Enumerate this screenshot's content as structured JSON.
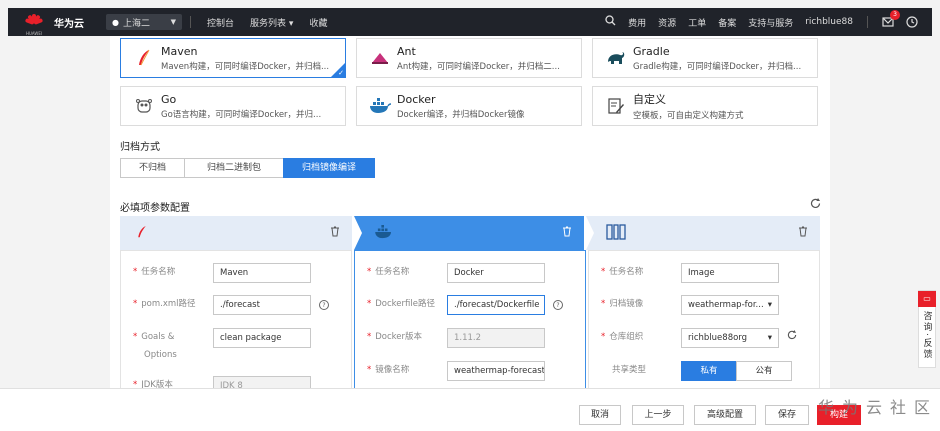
{
  "nav": {
    "brand": "华为云",
    "brand_sub": "HUAWEI",
    "region": "上海二",
    "links": [
      "控制台",
      "服务列表",
      "收藏"
    ],
    "service_caret": "▾",
    "right_links": [
      "费用",
      "资源",
      "工单",
      "备案",
      "支持与服务",
      "richblue88"
    ],
    "badge_count": "3"
  },
  "templates": [
    {
      "name": "Maven",
      "desc": "Maven构建，可同时编译Docker，并归档...",
      "icon": "maven-feather-icon",
      "selected": true
    },
    {
      "name": "Ant",
      "desc": "Ant构建，可同时编译Docker，并归档二...",
      "icon": "ant-icon"
    },
    {
      "name": "Gradle",
      "desc": "Gradle构建，可同时编译Docker，并归档...",
      "icon": "gradle-elephant-icon"
    },
    {
      "name": "Go",
      "desc": "Go语言构建，可同时编译Docker，并归...",
      "icon": "go-gopher-icon"
    },
    {
      "name": "Docker",
      "desc": "Docker编译，并归档Docker镜像",
      "icon": "docker-whale-icon"
    },
    {
      "name": "自定义",
      "desc": "空模板，可自由定义构建方式",
      "icon": "custom-edit-icon"
    }
  ],
  "archive": {
    "title": "归档方式",
    "options": [
      "不归档",
      "归档二进制包",
      "归档镜像编译"
    ],
    "selected": 2
  },
  "params": {
    "title": "必填项参数配置",
    "maven": {
      "fields": [
        {
          "label": "任务名称",
          "value": "Maven"
        },
        {
          "label": "pom.xml路径",
          "value": "./forecast"
        },
        {
          "label": "Goals &",
          "label2": "Options",
          "value": "clean package"
        },
        {
          "label": "JDK版本",
          "value": "JDK 8"
        }
      ]
    },
    "docker": {
      "fields": [
        {
          "label": "任务名称",
          "value": "Docker"
        },
        {
          "label": "Dockerfile路径",
          "value": "./forecast/Dockerfile"
        },
        {
          "label": "Docker版本",
          "value": "1.11.2"
        },
        {
          "label": "镜像名称",
          "value": "weathermap-forecast"
        }
      ]
    },
    "image": {
      "fields": [
        {
          "label": "任务名称",
          "value": "Image"
        },
        {
          "label": "归档镜像",
          "value": "weathermap-for..."
        },
        {
          "label": "仓库组织",
          "value": "richblue88org"
        }
      ],
      "share_label": "共享类型",
      "share_options": [
        "私有",
        "公有"
      ]
    }
  },
  "footer": {
    "buttons": [
      "取消",
      "上一步",
      "高级配置",
      "保存",
      "构建"
    ],
    "watermark": "华为云社区"
  },
  "feedback": "咨询·反馈",
  "colors": {
    "accent": "#2a7de1",
    "brand": "#e8202a",
    "nav_bg": "#20232a"
  }
}
